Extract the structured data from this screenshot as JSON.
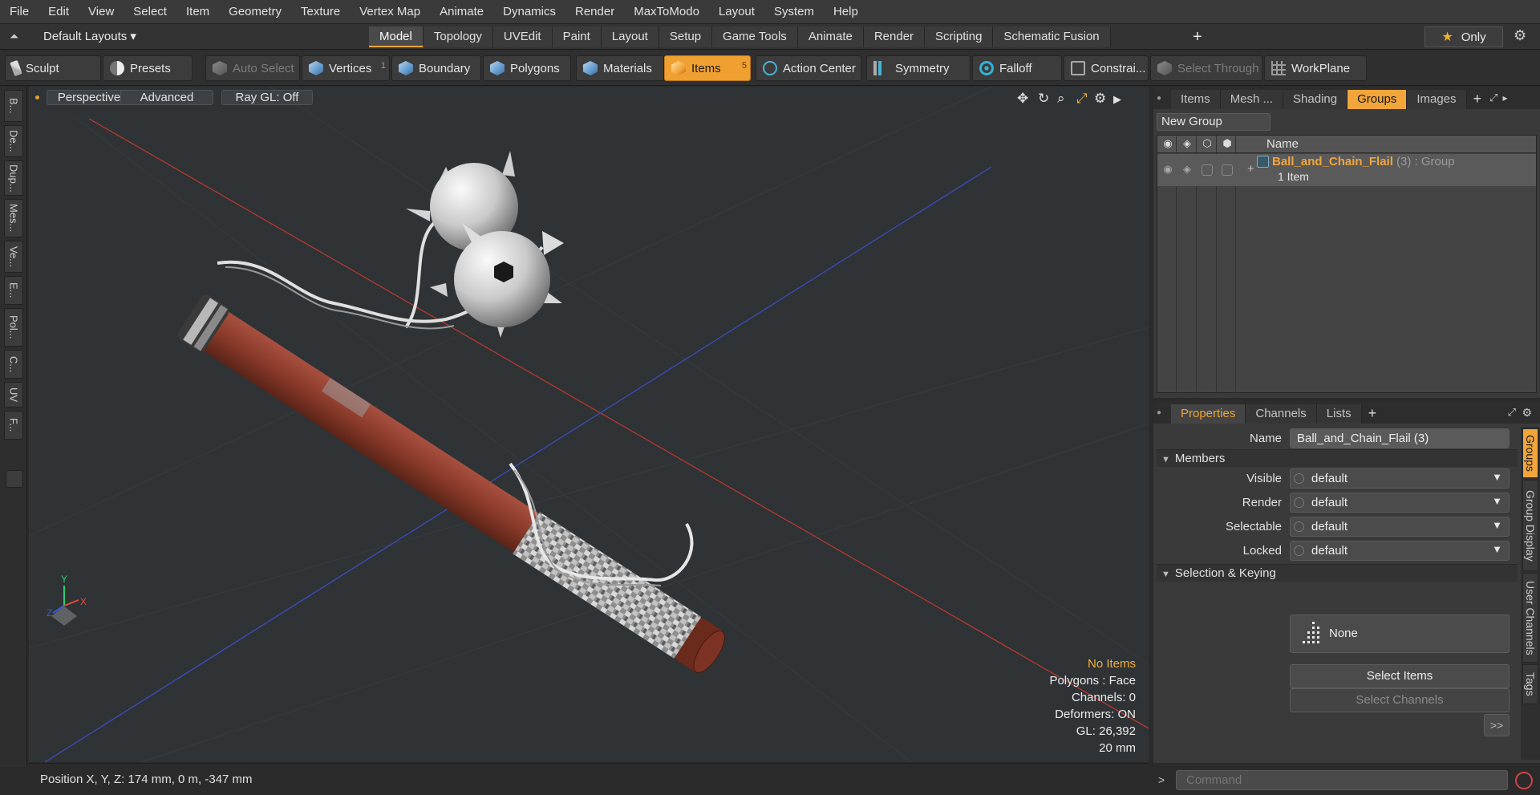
{
  "menubar": [
    "File",
    "Edit",
    "View",
    "Select",
    "Item",
    "Geometry",
    "Texture",
    "Vertex Map",
    "Animate",
    "Dynamics",
    "Render",
    "MaxToModo",
    "Layout",
    "System",
    "Help"
  ],
  "layoutbar": {
    "layout_select": "Default Layouts ▾",
    "tabs": [
      "Model",
      "Topology",
      "UVEdit",
      "Paint",
      "Layout",
      "Setup",
      "Game Tools",
      "Animate",
      "Render",
      "Scripting",
      "Schematic Fusion"
    ],
    "active_tab": "Model",
    "add": "+",
    "only_label": "Only",
    "star": "★"
  },
  "toolbar": {
    "sculpt": "Sculpt",
    "presets": "Presets",
    "auto_select": "Auto Select",
    "vertices": "Vertices",
    "vertices_count": "1",
    "boundary": "Boundary",
    "polygons": "Polygons",
    "materials": "Materials",
    "items": "Items",
    "items_count": "5",
    "action_center": "Action Center",
    "symmetry": "Symmetry",
    "falloff": "Falloff",
    "constraints": "Constrai...",
    "select_through": "Select Through",
    "workplane": "WorkPlane"
  },
  "left_tabs": [
    "B...",
    "De...",
    "Dup...",
    "Mes...",
    "Ve...",
    "E...",
    "Pol...",
    "C...",
    "UV",
    "F..."
  ],
  "viewport": {
    "perspective": "Perspective",
    "advanced": "Advanced",
    "ray_gl": "Ray GL: Off",
    "info": {
      "items": "No Items",
      "polygons": "Polygons : Face",
      "channels": "Channels: 0",
      "deformers": "Deformers: ON",
      "gl": "GL: 26,392",
      "scale": "20 mm"
    },
    "axis_x": "X",
    "axis_y": "Y",
    "axis_z": "Z"
  },
  "statusbar": {
    "position": "Position X, Y, Z:   174 mm, 0 m, -347 mm"
  },
  "top_panel": {
    "tabs": [
      "Items",
      "Mesh ...",
      "Shading",
      "Groups",
      "Images"
    ],
    "active_tab": "Groups",
    "add": "+",
    "new_group": "New Group",
    "col_name": "Name",
    "row": {
      "name": "Ball_and_Chain_Flail",
      "count": " (3)",
      "type": " : Group",
      "sub": "1 Item"
    }
  },
  "bottom_panel": {
    "tabs": [
      "Properties",
      "Channels",
      "Lists"
    ],
    "active_tab": "Properties",
    "add": "+",
    "side_tabs": [
      "Groups",
      "Group Display",
      "User Channels",
      "Tags"
    ],
    "name_label": "Name",
    "name_value": "Ball_and_Chain_Flail (3)",
    "members_section": "Members",
    "visible_label": "Visible",
    "visible_value": "default",
    "render_label": "Render",
    "render_value": "default",
    "selectable_label": "Selectable",
    "selectable_value": "default",
    "locked_label": "Locked",
    "locked_value": "default",
    "keying_section": "Selection & Keying",
    "none_label": "None",
    "select_items": "Select Items",
    "select_channels": "Select Channels",
    "more": ">>"
  },
  "command": {
    "placeholder": "Command",
    "arrow": ">"
  },
  "colors": {
    "accent": "#f2a53a",
    "viewport_bg": "#2f3336",
    "wood": "#8a3a2a"
  }
}
